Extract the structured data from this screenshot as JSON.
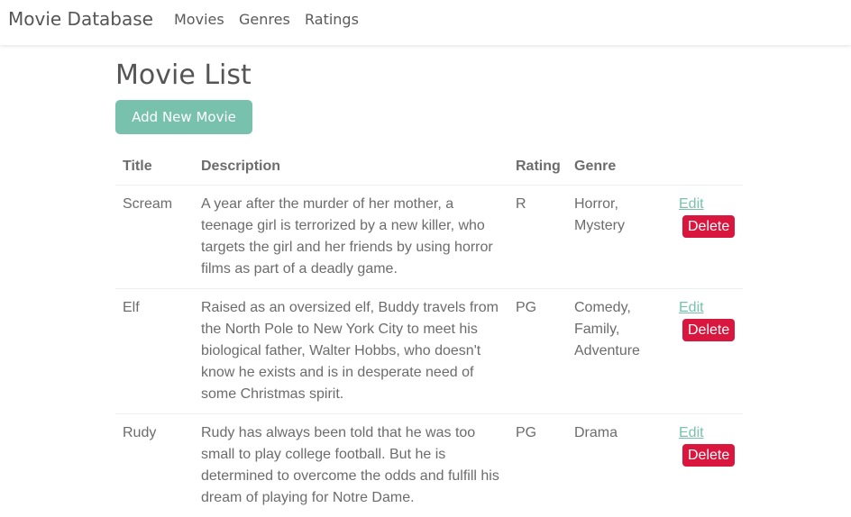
{
  "navbar": {
    "brand": "Movie Database",
    "links": [
      "Movies",
      "Genres",
      "Ratings"
    ]
  },
  "main": {
    "title": "Movie List",
    "add_button": "Add New Movie",
    "table": {
      "headers": [
        "Title",
        "Description",
        "Rating",
        "Genre",
        ""
      ],
      "rows": [
        {
          "title": "Scream",
          "description": "A year after the murder of her mother, a teenage girl is terrorized by a new killer, who targets the girl and her friends by using horror films as part of a deadly game.",
          "rating": "R",
          "genre": "Horror, Mystery",
          "edit": "Edit",
          "delete": "Delete"
        },
        {
          "title": "Elf",
          "description": "Raised as an oversized elf, Buddy travels from the North Pole to New York City to meet his biological father, Walter Hobbs, who doesn't know he exists and is in desperate need of some Christmas spirit.",
          "rating": "PG",
          "genre": "Comedy, Family, Adventure",
          "edit": "Edit",
          "delete": "Delete"
        },
        {
          "title": "Rudy",
          "description": "Rudy has always been told that he was too small to play college football. But he is determined to overcome the odds and fulfill his dream of playing for Notre Dame.",
          "rating": "PG",
          "genre": "Drama",
          "edit": "Edit",
          "delete": "Delete"
        }
      ]
    }
  },
  "colors": {
    "primary": "#78c2ad",
    "danger": "#d9173e",
    "text": "#5a5a5a"
  }
}
